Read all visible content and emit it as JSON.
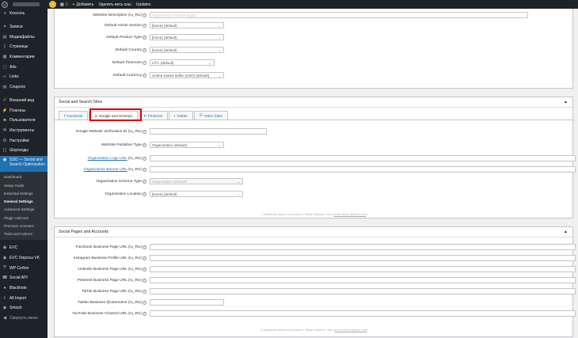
{
  "adminbar": {
    "comments_count": "0",
    "new_label": "Добавить",
    "delete_cache_label": "Удалить весь кэш",
    "updates_label": "Updates"
  },
  "sidebar": {
    "items_top": [
      {
        "label": "Консоль",
        "icon": "dashboard-icon"
      }
    ],
    "items_main": [
      {
        "label": "Записи",
        "icon": "pin-icon"
      },
      {
        "label": "Медиафайлы",
        "icon": "media-icon"
      },
      {
        "label": "Страницы",
        "icon": "page-icon"
      },
      {
        "label": "Комментарии",
        "icon": "comment-icon"
      },
      {
        "label": "Ads",
        "icon": "ads-icon"
      },
      {
        "label": "Links",
        "icon": "link-icon"
      },
      {
        "label": "Coupons",
        "icon": "coupon-icon"
      }
    ],
    "items_appearance": [
      {
        "label": "Внешний вид",
        "icon": "brush-icon"
      },
      {
        "label": "Плагины",
        "icon": "plugin-icon"
      },
      {
        "label": "Пользователи",
        "icon": "users-icon"
      },
      {
        "label": "Инструменты",
        "icon": "tools-icon"
      },
      {
        "label": "Настройки",
        "icon": "settings-icon"
      },
      {
        "label": "Шорткоды",
        "icon": "shortcode-icon"
      }
    ],
    "current": {
      "label": "SSO — Social and Search Optimization",
      "icon": "sso-icon"
    },
    "submenu": [
      "Dashboard",
      "Setup Guide",
      "Essential Settings",
      "General Settings",
      "Advanced Settings",
      "Plugin Add-ons",
      "Premium Licenses",
      "Tools and Actions"
    ],
    "submenu_current": 3,
    "items_bottom": [
      {
        "label": "EVC",
        "icon": "evc-icon"
      },
      {
        "label": "EVC Опросы VK",
        "icon": "evc-icon"
      },
      {
        "label": "WP Cerber",
        "icon": "shield-icon"
      },
      {
        "label": "Social API",
        "icon": "social-icon"
      },
      {
        "label": "Blackhole",
        "icon": "blackhole-icon"
      },
      {
        "label": "All Import",
        "icon": "import-icon"
      },
      {
        "label": "Smush",
        "icon": "smush-icon"
      }
    ],
    "collapse_label": "Свернуть меню"
  },
  "top_box": {
    "rows": [
      {
        "label": "WebSite Description",
        "locale": "(ru_RU)",
        "value": "Журнал про онлайн digital",
        "type": "ghost"
      },
      {
        "label": "Default Article Section",
        "locale": "",
        "value": "[None] (default)",
        "type": "select"
      },
      {
        "label": "Default Product Type",
        "locale": "",
        "value": "[None] (default)",
        "type": "select"
      },
      {
        "label": "Default Country",
        "locale": "",
        "value": "[None] (default)",
        "type": "select"
      },
      {
        "label": "Default Timezone",
        "locale": "",
        "value": "UTC (default)",
        "type": "select"
      },
      {
        "label": "Default Currency",
        "locale": "",
        "value": "United States dollar (USD) (default)",
        "type": "select"
      }
    ]
  },
  "social_search": {
    "title": "Social and Search Sites",
    "tabs": [
      {
        "label": "Facebook",
        "icon": "facebook-icon"
      },
      {
        "label": "Google and Schema",
        "icon": "google-icon"
      },
      {
        "label": "Pinterest",
        "icon": "pinterest-icon"
      },
      {
        "label": "Twitter",
        "icon": "twitter-icon"
      },
      {
        "label": "Other Sites",
        "icon": "other-sites-icon"
      }
    ],
    "active_tab": 1,
    "rows": [
      {
        "label": "Google Website Verification ID",
        "link": false,
        "locale": "(ru_RU)",
        "value": "",
        "type": "text"
      },
      {
        "label": "WebSite Publisher Type",
        "link": false,
        "locale": "",
        "value": "Organization (default)",
        "type": "select"
      },
      {
        "label": "Organization Logo URL",
        "link": true,
        "locale": "(ru_RU)",
        "value": "",
        "type": "text"
      },
      {
        "label": "Organization Banner URL",
        "link": true,
        "locale": "(ru_RU)",
        "value": "",
        "type": "text"
      },
      {
        "label": "Organization Schema Type",
        "link": false,
        "locale": "",
        "value": "Organization (default)",
        "type": "disabled"
      },
      {
        "label": "Organization Location",
        "link": false,
        "locale": "",
        "value": "[None] (default)",
        "type": "select"
      }
    ],
    "note_prefix": "1 additional option not shown in \"Basic Options\" view",
    "note_link": "show these options now"
  },
  "social_pages": {
    "title": "Social Pages and Accounts",
    "rows": [
      {
        "label": "Facebook Business Page URL",
        "locale": "(ru_RU)"
      },
      {
        "label": "Instagram Business Profile URL",
        "locale": "(ru_RU)"
      },
      {
        "label": "LinkedIn Business Page URL",
        "locale": "(ru_RU)"
      },
      {
        "label": "Pinterest Business Page URL",
        "locale": "(ru_RU)"
      },
      {
        "label": "TikTok Business Page URL",
        "locale": "(ru_RU)"
      },
      {
        "label": "Twitter Business @username",
        "locale": "(ru_RU)"
      },
      {
        "label": "YouTube Business Channel URL",
        "locale": "(ru_RU)"
      }
    ],
    "note_prefix": "6 additional options not shown in \"Basic Options\" view",
    "note_link": "show these options now"
  },
  "colors": {
    "accent": "#2271b1",
    "sidebar": "#1d2327",
    "highlight": "#d40000"
  }
}
